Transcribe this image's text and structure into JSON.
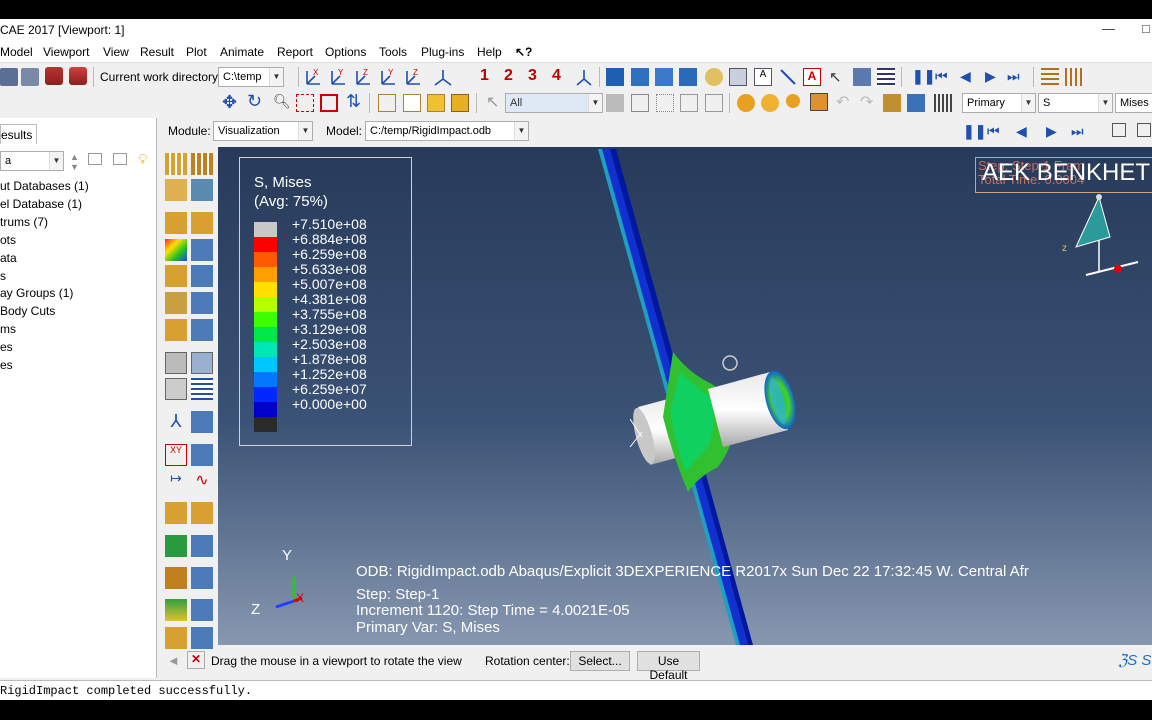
{
  "window": {
    "title": "CAE 2017 [Viewport: 1]"
  },
  "menu": [
    "Model",
    "Viewport",
    "View",
    "Result",
    "Plot",
    "Animate",
    "Report",
    "Options",
    "Tools",
    "Plug-ins",
    "Help"
  ],
  "toolbar": {
    "cwd_label": "Current work directory:",
    "cwd_value": "C:\\temp",
    "view_numbers": [
      "1",
      "2",
      "3",
      "4"
    ],
    "selection_filter": "All",
    "field_category": "Primary",
    "field_var": "S",
    "field_invariant": "Mises"
  },
  "context": {
    "module_label": "Module:",
    "module_value": "Visualization",
    "model_label": "Model:",
    "model_value": "C:/temp/RigidImpact.odb"
  },
  "tree": {
    "tab": "esults",
    "filter_value": "a",
    "items": [
      "ut Databases (1)",
      "el Database (1)",
      "trums (7)",
      "ots",
      "ata",
      "s",
      "ay Groups (1)",
      "Body Cuts",
      "ms",
      "es",
      "es"
    ]
  },
  "legend": {
    "title": "S, Mises",
    "subtitle": "(Avg: 75%)",
    "values": [
      "+7.510e+08",
      "+6.884e+08",
      "+6.259e+08",
      "+5.633e+08",
      "+5.007e+08",
      "+4.381e+08",
      "+3.755e+08",
      "+3.129e+08",
      "+2.503e+08",
      "+1.878e+08",
      "+1.252e+08",
      "+6.259e+07",
      "+0.000e+00"
    ],
    "colors": [
      "#c8c8c8",
      "#ff0000",
      "#ff5a00",
      "#ffa000",
      "#ffe000",
      "#b4ff00",
      "#3cff00",
      "#00e64b",
      "#00e6b4",
      "#00c8ff",
      "#0078ff",
      "#0028ff",
      "#0000c8",
      "#2a2a2a"
    ]
  },
  "viewport": {
    "watermark": "AEK BENKHET",
    "step_ghost": "Step: Step-1  Fram",
    "time_ghost": "Total Time: 0.0004",
    "odb_line": "ODB: RigidImpact.odb     Abaqus/Explicit 3DEXPERIENCE R2017x     Sun Dec 22 17:32:45 W. Central Afr",
    "step_line": "Step: Step-1",
    "increment_line": "Increment      1120: Step Time =     4.0021E-05",
    "primary_var_line": "Primary Var: S, Mises",
    "axis_y": "Y",
    "axis_z": "Z",
    "axis_x": "X",
    "triad_z": "z"
  },
  "prompt": {
    "text": "Drag the mouse in a viewport to rotate the view",
    "rotation_label": "Rotation center:",
    "select_button": "Select...",
    "default_button": "Use Default"
  },
  "message": " RigidImpact completed successfully."
}
